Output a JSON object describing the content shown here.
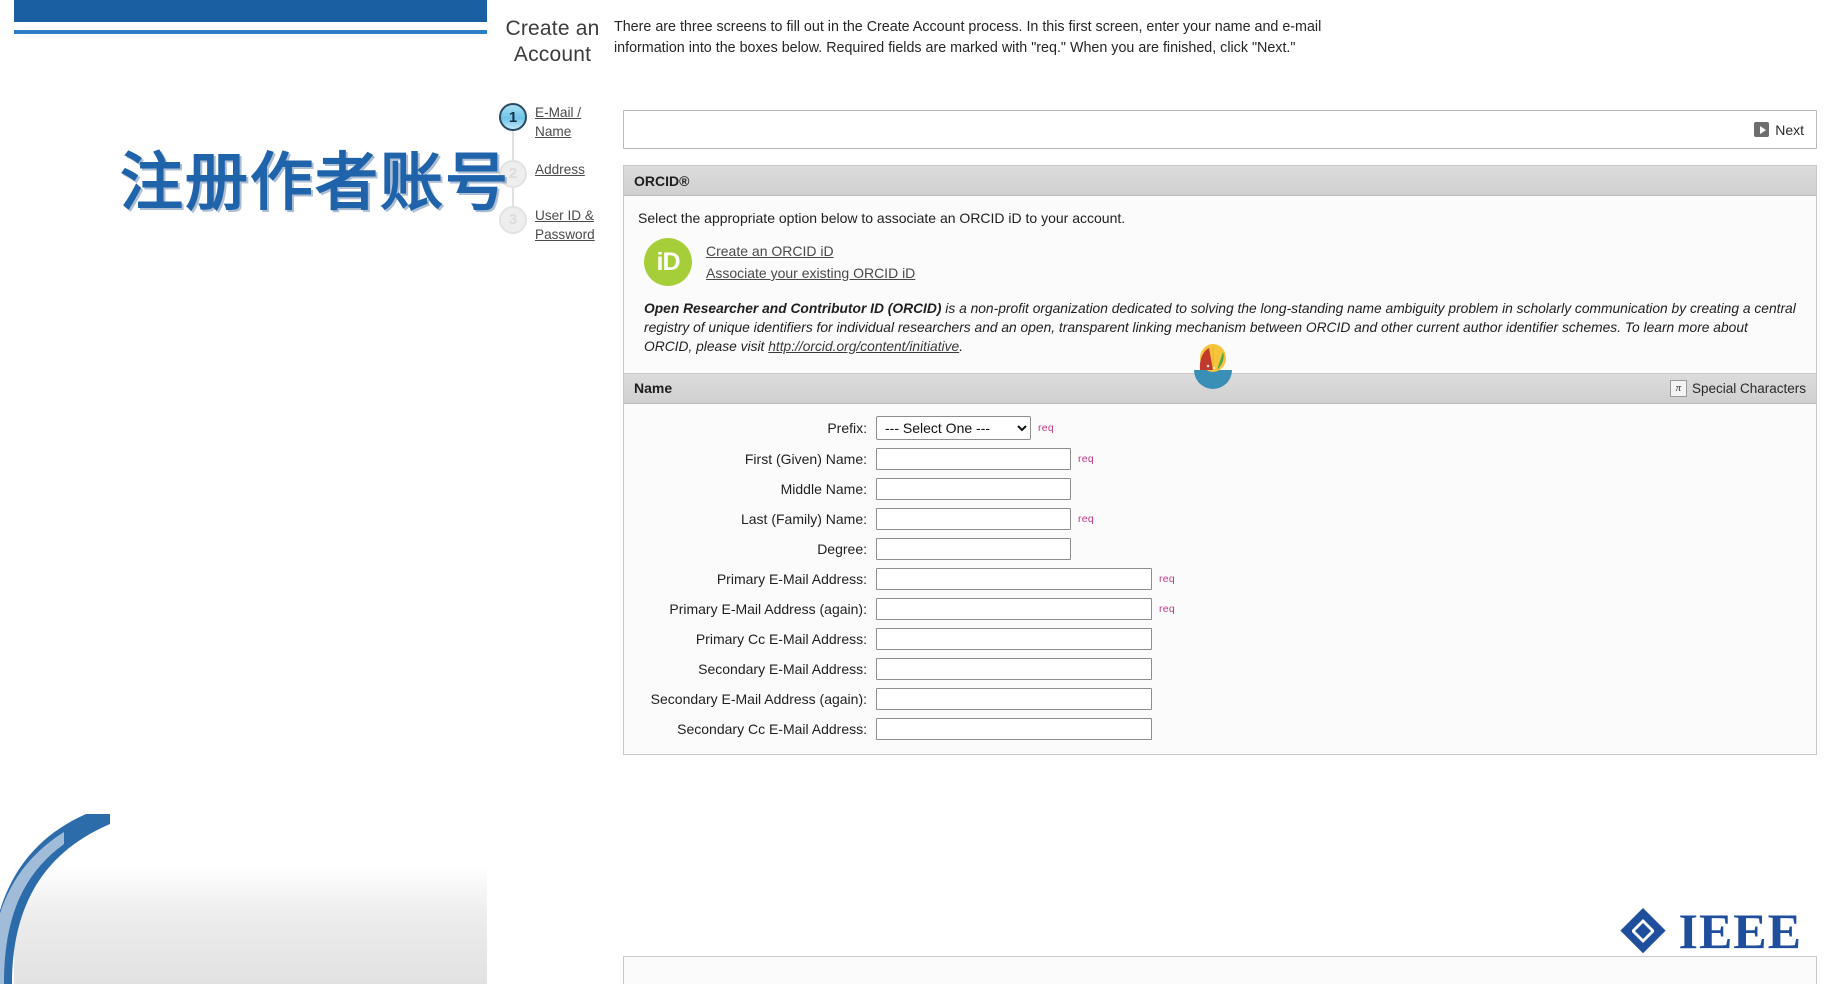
{
  "slide": {
    "title_cn": "注册作者账号",
    "brand": "IEEE",
    "accent_blue": "#1f63ab",
    "orcid_green": "#a6ce39",
    "req_pink": "#c0398b"
  },
  "screen": {
    "header": {
      "title": "Create an Account",
      "instructions": "There are three screens to fill out in the Create Account process. In this first screen, enter your name and e-mail information into the boxes below. Required fields are marked with \"req.\" When you are finished, click \"Next.\""
    },
    "steps": [
      {
        "number": "1",
        "label": "E-Mail / Name",
        "state": "active"
      },
      {
        "number": "2",
        "label": "Address",
        "state": "idle"
      },
      {
        "number": "3",
        "label": "User ID & Password",
        "state": "idle"
      }
    ],
    "toolbar": {
      "next_label": "Next"
    },
    "orcid": {
      "panel_title": "ORCID®",
      "lead": "Select the appropriate option below to associate an ORCID iD to your account.",
      "mark_text": "iD",
      "links": [
        "Create an ORCID iD",
        "Associate your existing ORCID iD"
      ],
      "desc_bold": "Open Researcher and Contributor ID (ORCID)",
      "desc_rest": " is a non-profit organization dedicated to solving the long-standing name ambiguity problem in scholarly communication by creating a central registry of unique identifiers for individual researchers and an open, transparent linking mechanism between ORCID and other current author identifier schemes. To learn more about ORCID, please visit ",
      "desc_link": "http://orcid.org/content/initiative",
      "desc_end": "."
    },
    "name_panel": {
      "panel_title": "Name",
      "special_characters_label": "Special Characters",
      "special_characters_icon": "pi-icon",
      "prefix_selected": "--- Select One ---",
      "req_marker": "req",
      "fields": [
        {
          "label": "Prefix:",
          "type": "select",
          "value": "--- Select One ---",
          "required": true,
          "width": "sel"
        },
        {
          "label": "First (Given) Name:",
          "type": "text",
          "value": "",
          "required": true,
          "width": "med"
        },
        {
          "label": "Middle Name:",
          "type": "text",
          "value": "",
          "required": false,
          "width": "med"
        },
        {
          "label": "Last (Family) Name:",
          "type": "text",
          "value": "",
          "required": true,
          "width": "med"
        },
        {
          "label": "Degree:",
          "type": "text",
          "value": "",
          "required": false,
          "width": "med"
        },
        {
          "label": "Primary E-Mail Address:",
          "type": "text",
          "value": "",
          "required": true,
          "width": "long"
        },
        {
          "label": "Primary E-Mail Address (again):",
          "type": "text",
          "value": "",
          "required": true,
          "width": "long"
        },
        {
          "label": "Primary Cc E-Mail Address:",
          "type": "text",
          "value": "",
          "required": false,
          "width": "long"
        },
        {
          "label": "Secondary E-Mail Address:",
          "type": "text",
          "value": "",
          "required": false,
          "width": "long"
        },
        {
          "label": "Secondary E-Mail Address (again):",
          "type": "text",
          "value": "",
          "required": false,
          "width": "long"
        },
        {
          "label": "Secondary Cc E-Mail Address:",
          "type": "text",
          "value": "",
          "required": false,
          "width": "long"
        }
      ]
    }
  }
}
